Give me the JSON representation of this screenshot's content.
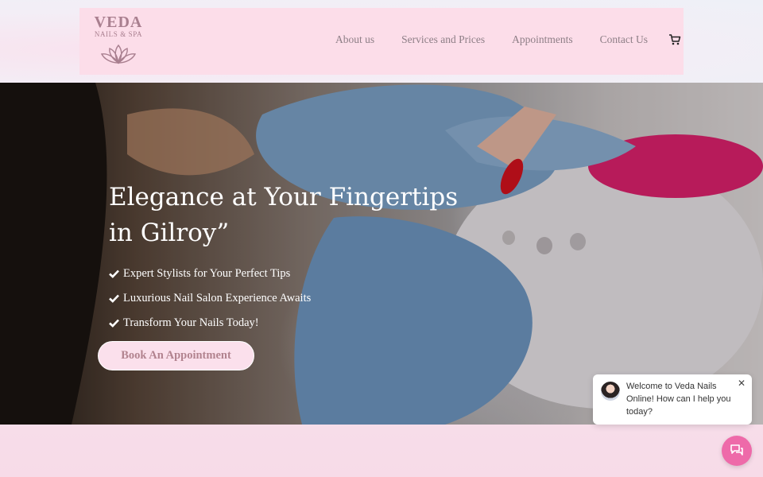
{
  "brand": {
    "name": "VEDA",
    "tagline": "NAILS & SPA"
  },
  "nav": {
    "items": [
      "About us",
      "Services and Prices",
      "Appointments",
      "Contact Us"
    ],
    "cart_icon": "cart-icon"
  },
  "hero": {
    "title": "Elegance at Your Fingertips in Gilroy”",
    "features": [
      "Expert Stylists for Your Perfect Tips",
      "Luxurious Nail Salon Experience Awaits",
      "Transform Your Nails Today!"
    ],
    "cta_label": "Book An Appointment"
  },
  "chat": {
    "message": "Welcome to Veda Nails Online! How can I help you today?",
    "close_glyph": "✕"
  },
  "colors": {
    "header_bg": "#fcdde9",
    "logo": "#a97f8f",
    "nav_text": "#8d7e86",
    "button_bg": "#fbe0ec",
    "button_text": "#b2838f",
    "chat_launcher": "#ee6aa9"
  }
}
